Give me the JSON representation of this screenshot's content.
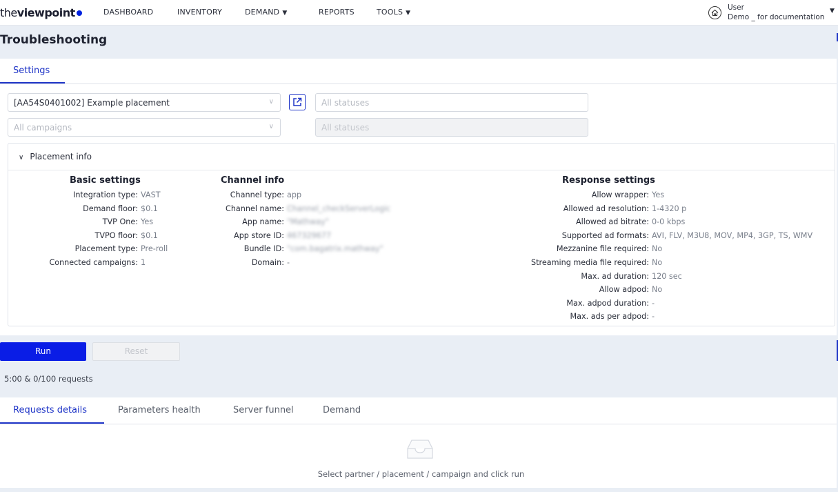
{
  "brand": {
    "thin": "the",
    "bold": "viewpoint"
  },
  "nav": [
    {
      "label": "DASHBOARD"
    },
    {
      "label": "INVENTORY"
    },
    {
      "label": "DEMAND",
      "caret": "▼"
    },
    {
      "label": "REPORTS"
    },
    {
      "label": "TOOLS",
      "caret": "▼"
    }
  ],
  "user": {
    "name": "User",
    "org": "Demo _ for documentation",
    "icon": "home-icon"
  },
  "page_title": "Troubleshooting",
  "tabs": {
    "settings": "Settings"
  },
  "filters": {
    "placement": "[AA54S0401002] Example placement",
    "placement_status_placeholder": "All statuses",
    "campaign_placeholder": "All campaigns",
    "campaign_status_placeholder": "All statuses"
  },
  "placement_info": {
    "title": "Placement info",
    "basic": {
      "title": "Basic settings",
      "rows": [
        {
          "label": "Integration type:",
          "value": "VAST"
        },
        {
          "label": "Demand floor:",
          "value": "$0.1"
        },
        {
          "label": "TVP One:",
          "value": "Yes"
        },
        {
          "label": "TVPO floor:",
          "value": "$0.1"
        },
        {
          "label": "Placement type:",
          "value": "Pre-roll"
        },
        {
          "label": "Connected campaigns:",
          "value": "1"
        }
      ]
    },
    "channel": {
      "title": "Channel info",
      "rows": [
        {
          "label": "Channel type:",
          "value": "app"
        },
        {
          "label": "Channel name:",
          "value": "Channel_checkServerLogic"
        },
        {
          "label": "App name:",
          "value": "\"Mathway\""
        },
        {
          "label": "App store ID:",
          "value": "467329677"
        },
        {
          "label": "Bundle ID:",
          "value": "\"com.bagatrix.mathway\""
        },
        {
          "label": "Domain:",
          "value": "-"
        }
      ]
    },
    "response": {
      "title": "Response settings",
      "rows": [
        {
          "label": "Allow wrapper:",
          "value": "Yes"
        },
        {
          "label": "Allowed ad resolution:",
          "value": "1-4320 p"
        },
        {
          "label": "Allowed ad bitrate:",
          "value": "0-0 kbps"
        },
        {
          "label": "Supported ad formats:",
          "value": "AVI, FLV, M3U8, MOV, MP4, 3GP, TS, WMV"
        },
        {
          "label": "Mezzanine file required:",
          "value": "No"
        },
        {
          "label": "Streaming media file required:",
          "value": "No"
        },
        {
          "label": "Max. ad duration:",
          "value": "120 sec"
        },
        {
          "label": "Allow adpod:",
          "value": "No"
        },
        {
          "label": "Max. adpod duration:",
          "value": "-"
        },
        {
          "label": "Max. ads per adpod:",
          "value": "-"
        }
      ]
    }
  },
  "actions": {
    "run": "Run",
    "reset": "Reset"
  },
  "request_status": "5:00 & 0/100 requests",
  "bottom_tabs": [
    "Requests details",
    "Parameters health",
    "Server funnel",
    "Demand"
  ],
  "empty_state": "Select partner / placement / campaign and click run",
  "colors": {
    "accent": "#1f35c7",
    "run_button": "#0a1de6",
    "background": "#e9eef5"
  }
}
